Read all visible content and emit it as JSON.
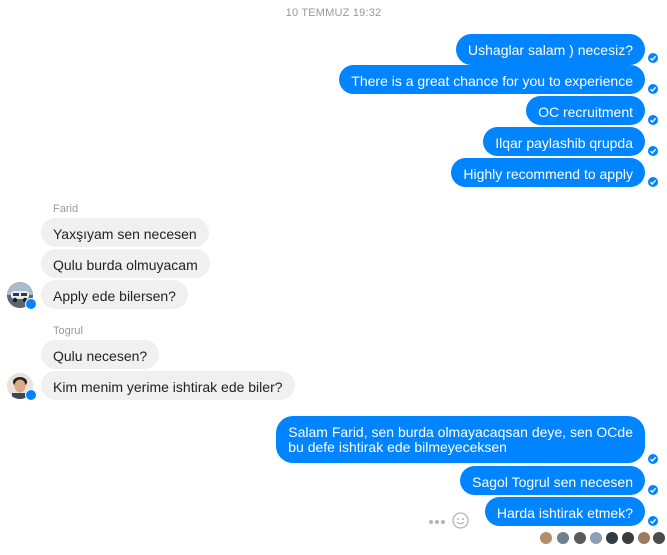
{
  "timestamp": "10 TEMMUZ 19:32",
  "outgoing_1": [
    "Ushaglar salam ) necesiz?",
    "There is a great chance for you to experience",
    "OC recruitment",
    "Ilqar paylashib qrupda",
    "Highly recommend to apply"
  ],
  "farid": {
    "name": "Farid",
    "messages": [
      "Yaxşıyam sen necesen",
      "Qulu burda olmuyacam",
      "Apply ede bilersen?"
    ]
  },
  "togrul": {
    "name": "Togrul",
    "messages": [
      "Qulu necesen?",
      "Kim menim yerime ishtirak ede biler?"
    ]
  },
  "outgoing_2": {
    "long_line1": "Salam Farid, sen burda olmayacaqsan deye, sen OCde",
    "long_line2": "bu defe ishtirak ede bilmeyeceksen",
    "m2": "Sagol Togrul sen necesen",
    "m3": "Harda ishtirak etmek?"
  },
  "colors": {
    "outgoing": "#0084ff",
    "incoming": "#f1f0f0",
    "meta_text": "#999999"
  },
  "icons": [
    "check-circle-icon",
    "more-dots-icon",
    "smiley-icon"
  ]
}
